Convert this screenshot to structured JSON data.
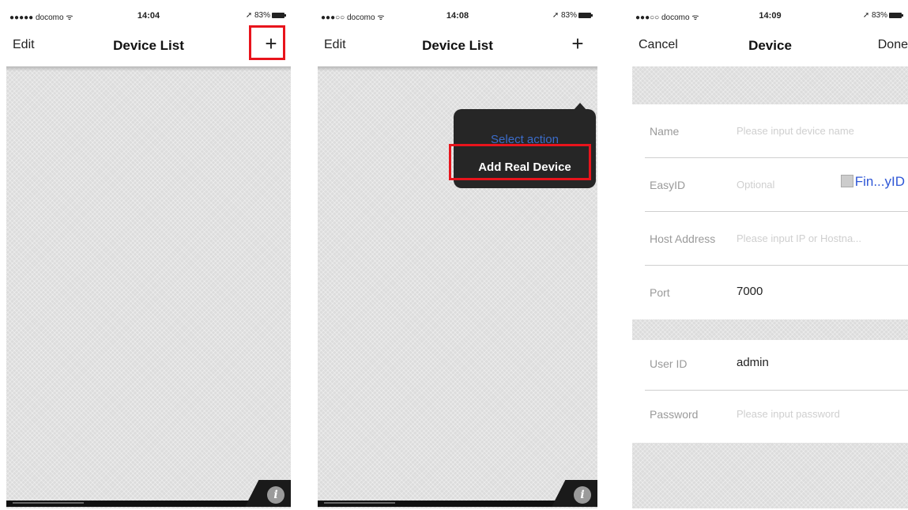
{
  "screens": [
    {
      "status": {
        "carrier": "●●●●● docomo ᯤ",
        "time": "14:04",
        "battery": "➚ 83%"
      },
      "nav": {
        "left": "Edit",
        "title": "Device List",
        "right": "+"
      }
    },
    {
      "status": {
        "carrier": "●●●○○ docomo ᯤ",
        "time": "14:08",
        "battery": "➚ 83%"
      },
      "nav": {
        "left": "Edit",
        "title": "Device List",
        "right": "+"
      },
      "popup": {
        "heading": "Select action",
        "action": "Add Real Device"
      }
    },
    {
      "status": {
        "carrier": "●●●○○ docomo ᯤ",
        "time": "14:09",
        "battery": "➚ 83%"
      },
      "nav": {
        "left": "Cancel",
        "title": "Device",
        "right": "Done"
      },
      "form": {
        "name": {
          "label": "Name",
          "placeholder": "Please input device name"
        },
        "easyid": {
          "label": "EasyID",
          "placeholder": "Optional",
          "finder": "Fin...yID"
        },
        "host": {
          "label": "Host Address",
          "placeholder": "Please input IP or Hostna..."
        },
        "port": {
          "label": "Port",
          "value": "7000"
        },
        "user": {
          "label": "User ID",
          "value": "admin"
        },
        "password": {
          "label": "Password",
          "placeholder": "Please input password"
        }
      }
    }
  ],
  "icons": {
    "info": "i",
    "highlight_color": "#e8141c",
    "accent": "#2f57d6"
  }
}
